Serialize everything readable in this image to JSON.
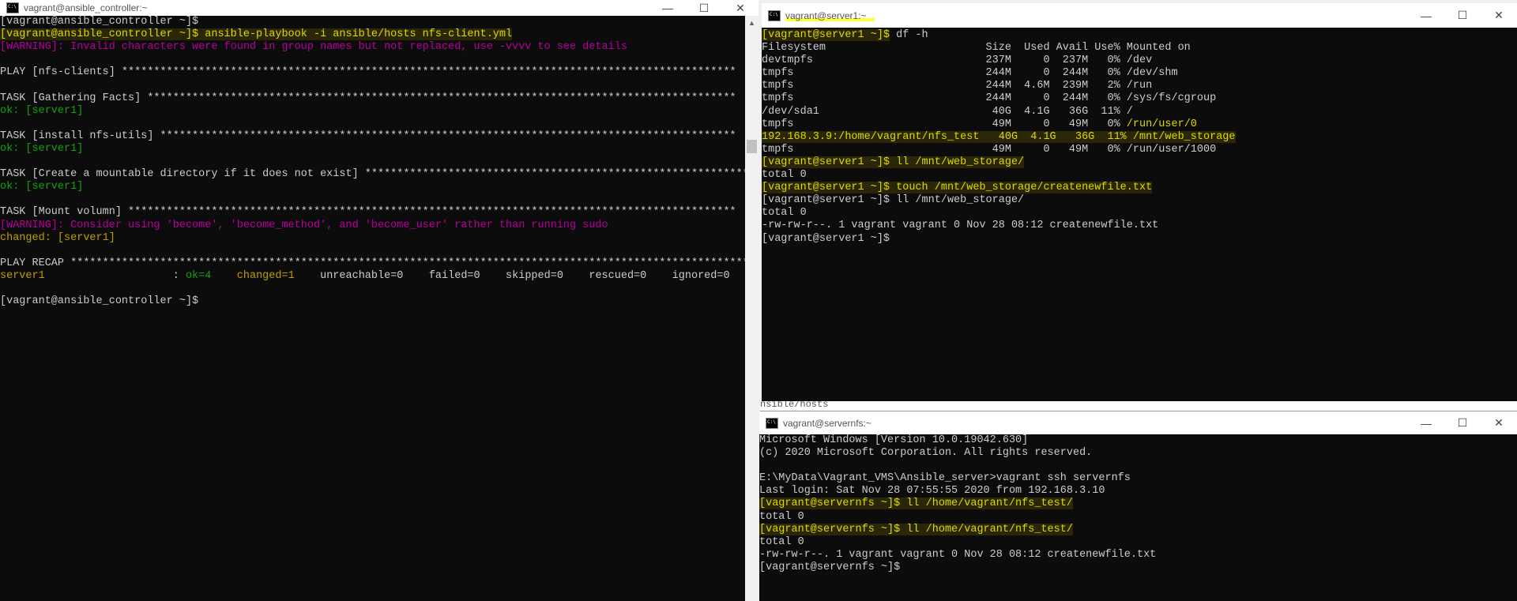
{
  "colors": {
    "bg": "#0c0c0c",
    "text": "#cccccc",
    "yellow": "#c19c00",
    "green": "#13a10e",
    "magenta": "#b4009e",
    "prompt_hl": "#e0d800"
  },
  "left_window": {
    "title": "vagrant@ansible_controller:~",
    "buttons": {
      "minimize": "—",
      "maximize": "☐",
      "close": "✕"
    },
    "lines": [
      [
        {
          "t": "[vagrant@ansible_controller ~]$",
          "c": "text"
        }
      ],
      [
        {
          "t": "[vagrant@ansible_controller ~]$ ansible-playbook -i ansible/hosts nfs-client.yml",
          "c": "prompt_hl",
          "hl": true
        }
      ],
      [
        {
          "t": "[WARNING]: Invalid characters were found in group names but not replaced, use -vvvv to see details",
          "c": "magenta"
        }
      ],
      [],
      [
        {
          "t": "PLAY [nfs-clients] ************************************************************************************************",
          "c": "text"
        }
      ],
      [],
      [
        {
          "t": "TASK [Gathering Facts] ********************************************************************************************",
          "c": "text"
        }
      ],
      [
        {
          "t": "ok: [server1]",
          "c": "green"
        }
      ],
      [],
      [
        {
          "t": "TASK [install nfs-utils] ******************************************************************************************",
          "c": "text"
        }
      ],
      [
        {
          "t": "ok: [server1]",
          "c": "green"
        }
      ],
      [],
      [
        {
          "t": "TASK [Create a mountable directory if it does not exist] **************************************************************",
          "c": "text"
        }
      ],
      [
        {
          "t": "ok: [server1]",
          "c": "green"
        }
      ],
      [],
      [
        {
          "t": "TASK [Mount volumn] ***********************************************************************************************",
          "c": "text"
        }
      ],
      [
        {
          "t": "[WARNING]: Consider using 'become', 'become_method', and 'become_user' rather than running sudo",
          "c": "magenta"
        }
      ],
      [
        {
          "t": "changed: [server1]",
          "c": "yellow"
        }
      ],
      [],
      [
        {
          "t": "PLAY RECAP ************************************************************************************************************",
          "c": "text"
        }
      ],
      [
        {
          "t": "server1",
          "c": "yellow"
        },
        {
          "t": "                    : ",
          "c": "text"
        },
        {
          "t": "ok=4",
          "c": "green"
        },
        {
          "t": "    ",
          "c": "text"
        },
        {
          "t": "changed=1",
          "c": "yellow"
        },
        {
          "t": "    unreachable=0    failed=0    skipped=0    rescued=0    ignored=0",
          "c": "text"
        }
      ],
      [],
      [
        {
          "t": "[vagrant@ansible_controller ~]$",
          "c": "text"
        }
      ]
    ]
  },
  "server1_window": {
    "title": "vagrant@server1:~",
    "buttons": {
      "minimize": "—",
      "maximize": "☐",
      "close": "✕"
    },
    "lines": [
      [
        {
          "t": "[vagrant@server1 ~]$",
          "c": "prompt_hl",
          "hl": true
        },
        {
          "t": " df -h",
          "c": "text"
        }
      ],
      [
        {
          "t": "Filesystem                         Size  Used Avail Use% Mounted on",
          "c": "text"
        }
      ],
      [
        {
          "t": "devtmpfs                           237M     0  237M   0% /dev",
          "c": "text"
        }
      ],
      [
        {
          "t": "tmpfs                              244M     0  244M   0% /dev/shm",
          "c": "text"
        }
      ],
      [
        {
          "t": "tmpfs                              244M  4.6M  239M   2% /run",
          "c": "text"
        }
      ],
      [
        {
          "t": "tmpfs                              244M     0  244M   0% /sys/fs/cgroup",
          "c": "text"
        }
      ],
      [
        {
          "t": "/dev/sda1                           40G  4.1G   36G  11% /",
          "c": "text"
        }
      ],
      [
        {
          "t": "tmpfs                               49M     0   49M   0% ",
          "c": "text"
        },
        {
          "t": "/run/user/0",
          "c": "prompt_hl"
        }
      ],
      [
        {
          "t": "192.168.3.9:/home/vagrant/nfs_test   40G  4.1G   36G  11% /mnt/web_storage",
          "c": "prompt_hl",
          "hl": true
        }
      ],
      [
        {
          "t": "tmpfs                               49M     0   49M   0% /run/user/1000",
          "c": "text"
        }
      ],
      [
        {
          "t": "[vagrant@server1 ~]$ ll /mnt/web_storage/",
          "c": "prompt_hl",
          "hl": true
        }
      ],
      [
        {
          "t": "total 0",
          "c": "text"
        }
      ],
      [
        {
          "t": "[vagrant@server1 ~]$ touch /mnt/web_storage/createnewfile.txt",
          "c": "prompt_hl",
          "hl": true
        }
      ],
      [
        {
          "t": "[vagrant@server1 ~]$ ll /mnt/web_storage/",
          "c": "text"
        }
      ],
      [
        {
          "t": "total 0",
          "c": "text"
        }
      ],
      [
        {
          "t": "-rw-rw-r--. 1 vagrant vagrant 0 Nov 28 08:12 createnewfile.txt",
          "c": "text"
        }
      ],
      [
        {
          "t": "[vagrant@server1 ~]$",
          "c": "text"
        }
      ]
    ]
  },
  "background_fragment": "nsible/hosts",
  "servernfs_window": {
    "title": "vagrant@servernfs:~",
    "buttons": {
      "minimize": "—",
      "maximize": "☐",
      "close": "✕"
    },
    "lines": [
      [
        {
          "t": "Microsoft Windows [Version 10.0.19042.630]",
          "c": "text"
        }
      ],
      [
        {
          "t": "(c) 2020 Microsoft Corporation. All rights reserved.",
          "c": "text"
        }
      ],
      [],
      [
        {
          "t": "E:\\MyData\\Vagrant_VMS\\Ansible_server>vagrant ssh servernfs",
          "c": "text"
        }
      ],
      [
        {
          "t": "Last login: Sat Nov 28 07:55:55 2020 from 192.168.3.10",
          "c": "text"
        }
      ],
      [
        {
          "t": "[vagrant@servernfs ~]$ ll /home/vagrant/nfs_test/",
          "c": "prompt_hl",
          "hl": true
        }
      ],
      [
        {
          "t": "total 0",
          "c": "text"
        }
      ],
      [
        {
          "t": "[vagrant@servernfs ~]$ ll /home/vagrant/nfs_test/",
          "c": "prompt_hl",
          "hl": true
        }
      ],
      [
        {
          "t": "total 0",
          "c": "text"
        }
      ],
      [
        {
          "t": "-rw-rw-r--. 1 vagrant vagrant 0 Nov 28 08:12 createnewfile.txt",
          "c": "text"
        }
      ],
      [
        {
          "t": "[vagrant@servernfs ~]$",
          "c": "text"
        }
      ]
    ]
  }
}
